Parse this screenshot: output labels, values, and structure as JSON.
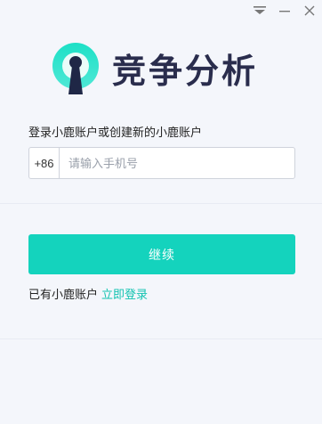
{
  "logo": {
    "title": "竞争分析"
  },
  "colors": {
    "accent": "#14d3bd",
    "link": "#12c3b0",
    "logo_dark": "#2a2d4d"
  },
  "titlebar": {
    "icons": [
      "dropdown-triangle-icon",
      "minimize-icon",
      "close-icon"
    ]
  },
  "form": {
    "prompt": "登录小鹿账户或创建新的小鹿账户",
    "country_code": "+86",
    "phone_placeholder": "请输入手机号",
    "continue_label": "继续",
    "have_account_text": "已有小鹿账户",
    "login_link": "立即登录"
  }
}
